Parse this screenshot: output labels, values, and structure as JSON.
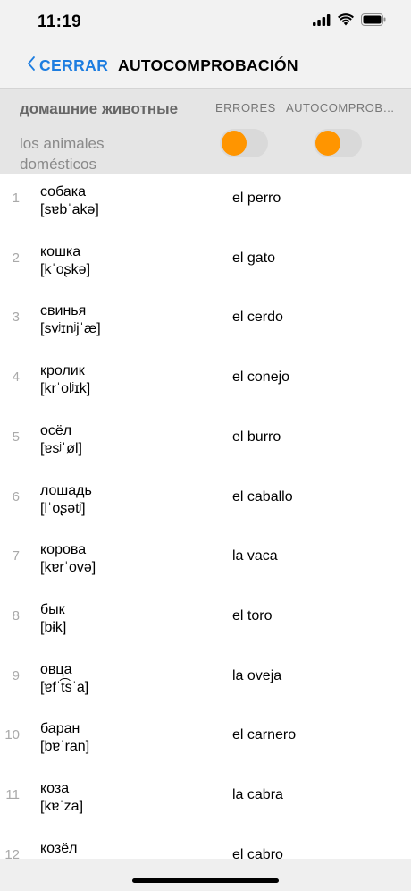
{
  "status": {
    "time": "11:19"
  },
  "nav": {
    "back_label": "CERRAR",
    "title": "AUTOCOMPROBACIÓN"
  },
  "header": {
    "title": "домашние животные",
    "subtitle_line1": "los animales",
    "subtitle_line2": "domésticos",
    "col_errors": "ERRORES",
    "col_selfcheck": "AUTOCOMPROB…",
    "errors_toggle_on": true,
    "selfcheck_toggle_on": true
  },
  "colors": {
    "accent": "#ff9500",
    "link": "#1d7de0"
  },
  "words": [
    {
      "num": "1",
      "word": "собака",
      "ipa": "[sɐbˈakə]",
      "tr": "el perro"
    },
    {
      "num": "2",
      "word": "кошка",
      "ipa": "[kˈoʂkə]",
      "tr": "el gato"
    },
    {
      "num": "3",
      "word": "свинья",
      "ipa": "[svʲɪnʲjˈæ]",
      "tr": "el cerdo"
    },
    {
      "num": "4",
      "word": "кролик",
      "ipa": "[krˈolʲɪk]",
      "tr": "el conejo"
    },
    {
      "num": "5",
      "word": "осёл",
      "ipa": "[ɐsʲˈøl]",
      "tr": "el burro"
    },
    {
      "num": "6",
      "word": "лошадь",
      "ipa": "[lˈoʂətʲ]",
      "tr": "el caballo"
    },
    {
      "num": "7",
      "word": "корова",
      "ipa": "[kɐrˈovə]",
      "tr": "la vaca"
    },
    {
      "num": "8",
      "word": "бык",
      "ipa": "[bɨk]",
      "tr": "el toro"
    },
    {
      "num": "9",
      "word": "овца",
      "ipa": "[ɐfˈt͡sˈa]",
      "tr": "la oveja"
    },
    {
      "num": "10",
      "word": "баран",
      "ipa": "[bɐˈran]",
      "tr": "el carnero"
    },
    {
      "num": "11",
      "word": "коза",
      "ipa": "[kɐˈza]",
      "tr": "la cabra"
    },
    {
      "num": "12",
      "word": "козёл",
      "ipa": "",
      "tr": "el cabro"
    }
  ]
}
